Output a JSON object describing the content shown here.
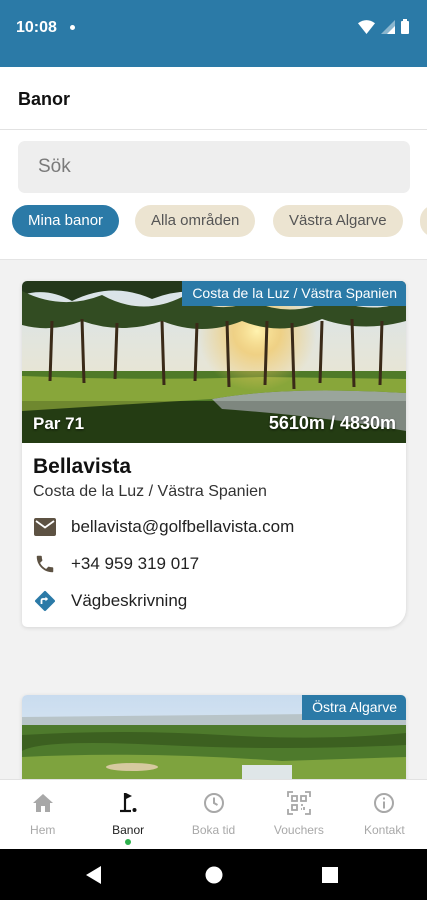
{
  "status_bar": {
    "time": "10:08"
  },
  "header": {
    "title": "Banor"
  },
  "search": {
    "placeholder": "Sök"
  },
  "filters": [
    {
      "label": "Mina banor",
      "selected": true
    },
    {
      "label": "Alla områden",
      "selected": false
    },
    {
      "label": "Västra Algarve",
      "selected": false
    }
  ],
  "courses": [
    {
      "region_tag": "Costa de la Luz / Västra Spanien",
      "par": "Par 71",
      "length": "5610m / 4830m",
      "name": "Bellavista",
      "region": "Costa de la Luz / Västra Spanien",
      "email": "bellavista@golfbellavista.com",
      "phone": "+34 959 319 017",
      "directions_label": "Vägbeskrivning"
    },
    {
      "region_tag": "Östra Algarve"
    }
  ],
  "bottom_nav": {
    "items": [
      {
        "label": "Hem",
        "icon": "home-icon"
      },
      {
        "label": "Banor",
        "icon": "golf-flag-icon",
        "active": true
      },
      {
        "label": "Boka tid",
        "icon": "clock-icon"
      },
      {
        "label": "Vouchers",
        "icon": "qr-code-icon"
      },
      {
        "label": "Kontakt",
        "icon": "info-icon"
      }
    ]
  },
  "colors": {
    "primary": "#2b7aa7",
    "chip_inactive": "#ece4d1",
    "active_indicator": "#2db04c",
    "icon_brown": "#5d5243"
  }
}
